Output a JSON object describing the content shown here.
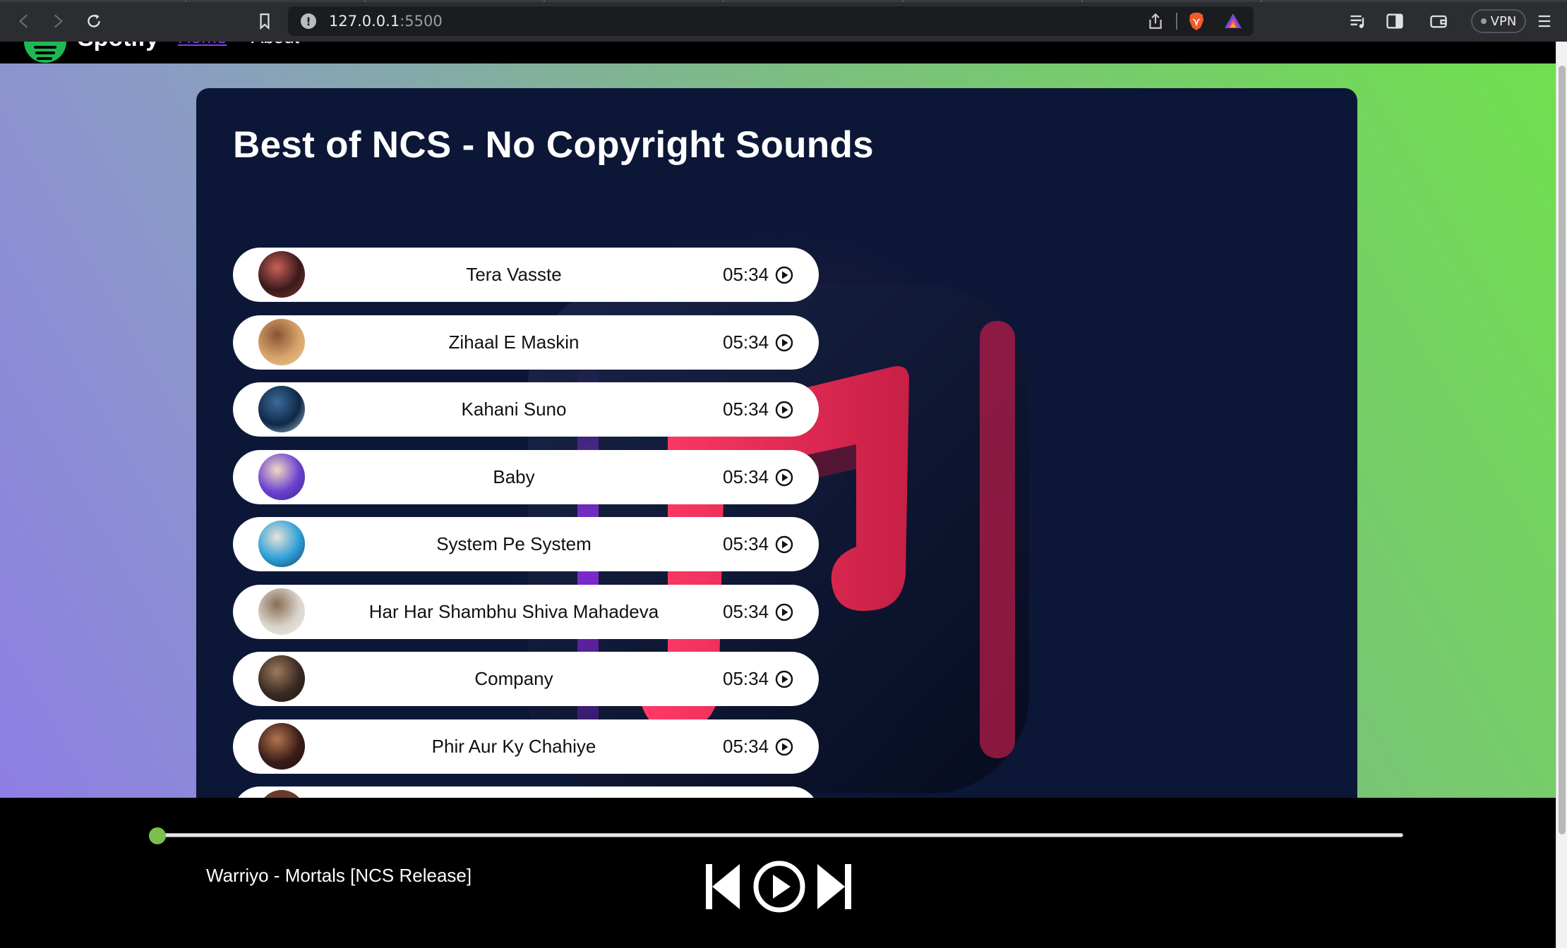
{
  "browser": {
    "url_host": "127.0.0.1",
    "url_port": ":5500",
    "vpn_label": "VPN"
  },
  "nav": {
    "brand": "Spotify",
    "links": [
      "Home",
      "About"
    ]
  },
  "playlist": {
    "title": "Best of NCS - No Copyright Sounds",
    "songs": [
      {
        "name": "Tera Vasste",
        "duration": "05:34",
        "thumb_colors": [
          "#3a1a1a",
          "#c9615a",
          "#7a3b2f"
        ]
      },
      {
        "name": "Zihaal E Maskin",
        "duration": "05:34",
        "thumb_colors": [
          "#d7a46a",
          "#8a5233",
          "#e7c89a"
        ]
      },
      {
        "name": "Kahani Suno",
        "duration": "05:34",
        "thumb_colors": [
          "#0f2846",
          "#3b6b9a",
          "#aac3dd"
        ]
      },
      {
        "name": "Baby",
        "duration": "05:34",
        "thumb_colors": [
          "#6a3fd0",
          "#f0d9c3",
          "#3b2a8a"
        ]
      },
      {
        "name": "System Pe System",
        "duration": "05:34",
        "thumb_colors": [
          "#2b9ed8",
          "#e9e3d7",
          "#203a59"
        ]
      },
      {
        "name": "Har Har Shambhu Shiva Mahadeva",
        "duration": "05:34",
        "thumb_colors": [
          "#d9d4cb",
          "#8a6d55",
          "#f4efe6"
        ]
      },
      {
        "name": "Company",
        "duration": "05:34",
        "thumb_colors": [
          "#3a2a22",
          "#9b7b5c",
          "#1b1512"
        ]
      },
      {
        "name": "Phir Aur Ky Chahiye",
        "duration": "05:34",
        "thumb_colors": [
          "#3b1d1a",
          "#b3744c",
          "#1e0f0c"
        ]
      }
    ]
  },
  "player": {
    "now_playing": "Warriyo - Mortals [NCS Release]",
    "progress": 0,
    "accent_color": "#7cc04b",
    "controls": [
      "previous-icon",
      "play-circle-icon",
      "next-icon"
    ]
  },
  "colors": {
    "container_bg": "#0c1737",
    "note_color": "#e43a5f",
    "link_visited": "#7f3fe3"
  }
}
